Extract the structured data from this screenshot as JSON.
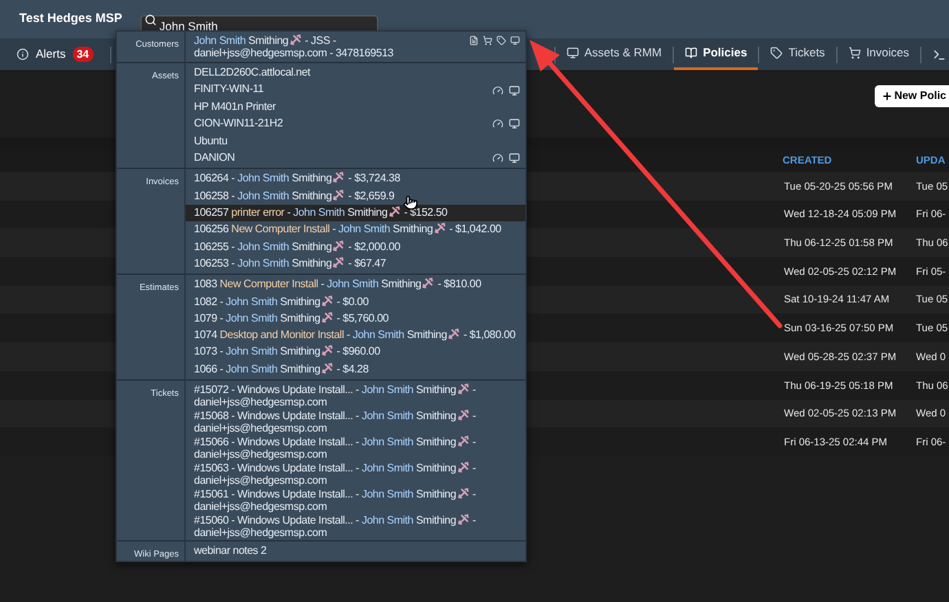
{
  "app_title": "Test Hedges MSP",
  "search": {
    "value": "John Smith"
  },
  "nav": {
    "alerts": {
      "label": "Alerts",
      "count": "34"
    },
    "tabs": [
      {
        "label": "Assets & RMM",
        "selected": false
      },
      {
        "label": "Policies",
        "selected": true
      },
      {
        "label": "Tickets",
        "selected": false
      },
      {
        "label": "Invoices",
        "selected": false
      }
    ]
  },
  "results": [
    {
      "label": "Customers",
      "kind": "customer",
      "items": [
        {
          "hovered": false,
          "parts": [
            {
              "kind": "match",
              "t": "John Smith"
            },
            {
              "kind": "text",
              "t": " Smithing"
            },
            {
              "kind": "icon"
            },
            {
              "kind": "text",
              "t": " - JSS - daniel+jss@hedgesmsp.com - 3478169513"
            }
          ]
        }
      ]
    },
    {
      "label": "Assets",
      "kind": "asset",
      "items": [
        {
          "hovered": false,
          "agent": false,
          "parts": [
            {
              "kind": "text",
              "t": "DELL2D260C.attlocal.net"
            }
          ]
        },
        {
          "hovered": false,
          "agent": true,
          "parts": [
            {
              "kind": "text",
              "t": "FINITY-WIN-11"
            }
          ]
        },
        {
          "hovered": false,
          "agent": false,
          "parts": [
            {
              "kind": "text",
              "t": "HP M401n Printer"
            }
          ]
        },
        {
          "hovered": false,
          "agent": true,
          "parts": [
            {
              "kind": "text",
              "t": "CION-WIN11-21H2"
            }
          ]
        },
        {
          "hovered": false,
          "agent": false,
          "parts": [
            {
              "kind": "text",
              "t": "Ubuntu"
            }
          ]
        },
        {
          "hovered": false,
          "agent": true,
          "parts": [
            {
              "kind": "text",
              "t": "DANION"
            }
          ]
        }
      ]
    },
    {
      "label": "Invoices",
      "kind": "line",
      "items": [
        {
          "hovered": false,
          "parts": [
            {
              "kind": "text",
              "t": "106264 - "
            },
            {
              "kind": "match",
              "t": "John Smith"
            },
            {
              "kind": "text",
              "t": " Smithing"
            },
            {
              "kind": "icon"
            },
            {
              "kind": "text",
              "t": " - $3,724.38"
            }
          ]
        },
        {
          "hovered": false,
          "parts": [
            {
              "kind": "text",
              "t": "106258 - "
            },
            {
              "kind": "match",
              "t": "John Smith"
            },
            {
              "kind": "text",
              "t": " Smithing"
            },
            {
              "kind": "icon"
            },
            {
              "kind": "text",
              "t": " - $2,659.9"
            }
          ]
        },
        {
          "hovered": true,
          "parts": [
            {
              "kind": "text",
              "t": "106257 "
            },
            {
              "kind": "accent",
              "t": "printer error"
            },
            {
              "kind": "text",
              "t": " - "
            },
            {
              "kind": "match",
              "t": "John Smith"
            },
            {
              "kind": "text",
              "t": " Smithing"
            },
            {
              "kind": "icon"
            },
            {
              "kind": "text",
              "t": " - $152.50"
            }
          ]
        },
        {
          "hovered": false,
          "parts": [
            {
              "kind": "text",
              "t": "106256 "
            },
            {
              "kind": "accent",
              "t": "New Computer Install"
            },
            {
              "kind": "text",
              "t": " - "
            },
            {
              "kind": "match",
              "t": "John Smith"
            },
            {
              "kind": "text",
              "t": " Smithing"
            },
            {
              "kind": "icon"
            },
            {
              "kind": "text",
              "t": " - $1,042.00"
            }
          ]
        },
        {
          "hovered": false,
          "parts": [
            {
              "kind": "text",
              "t": "106255 - "
            },
            {
              "kind": "match",
              "t": "John Smith"
            },
            {
              "kind": "text",
              "t": " Smithing"
            },
            {
              "kind": "icon"
            },
            {
              "kind": "text",
              "t": " - $2,000.00"
            }
          ]
        },
        {
          "hovered": false,
          "parts": [
            {
              "kind": "text",
              "t": "106253 - "
            },
            {
              "kind": "match",
              "t": "John Smith"
            },
            {
              "kind": "text",
              "t": " Smithing"
            },
            {
              "kind": "icon"
            },
            {
              "kind": "text",
              "t": " - $67.47"
            }
          ]
        }
      ]
    },
    {
      "label": "Estimates",
      "kind": "line",
      "items": [
        {
          "hovered": false,
          "parts": [
            {
              "kind": "text",
              "t": "1083 "
            },
            {
              "kind": "accent",
              "t": "New Computer Install"
            },
            {
              "kind": "text",
              "t": " - "
            },
            {
              "kind": "match",
              "t": "John Smith"
            },
            {
              "kind": "text",
              "t": " Smithing"
            },
            {
              "kind": "icon"
            },
            {
              "kind": "text",
              "t": " - $810.00"
            }
          ]
        },
        {
          "hovered": false,
          "parts": [
            {
              "kind": "text",
              "t": "1082 - "
            },
            {
              "kind": "match",
              "t": "John Smith"
            },
            {
              "kind": "text",
              "t": " Smithing"
            },
            {
              "kind": "icon"
            },
            {
              "kind": "text",
              "t": " - $0.00"
            }
          ]
        },
        {
          "hovered": false,
          "parts": [
            {
              "kind": "text",
              "t": "1079 - "
            },
            {
              "kind": "match",
              "t": "John Smith"
            },
            {
              "kind": "text",
              "t": " Smithing"
            },
            {
              "kind": "icon"
            },
            {
              "kind": "text",
              "t": " - $5,760.00"
            }
          ]
        },
        {
          "hovered": false,
          "parts": [
            {
              "kind": "text",
              "t": "1074 "
            },
            {
              "kind": "accent",
              "t": "Desktop and Monitor Install"
            },
            {
              "kind": "text",
              "t": " - "
            },
            {
              "kind": "match",
              "t": "John Smith"
            },
            {
              "kind": "text",
              "t": " Smithing"
            },
            {
              "kind": "icon"
            },
            {
              "kind": "text",
              "t": " - $1,080.00"
            }
          ]
        },
        {
          "hovered": false,
          "parts": [
            {
              "kind": "text",
              "t": "1073 - "
            },
            {
              "kind": "match",
              "t": "John Smith"
            },
            {
              "kind": "text",
              "t": " Smithing"
            },
            {
              "kind": "icon"
            },
            {
              "kind": "text",
              "t": " - $960.00"
            }
          ]
        },
        {
          "hovered": false,
          "parts": [
            {
              "kind": "text",
              "t": "1066 - "
            },
            {
              "kind": "match",
              "t": "John Smith"
            },
            {
              "kind": "text",
              "t": " Smithing"
            },
            {
              "kind": "icon"
            },
            {
              "kind": "text",
              "t": " - $4.28"
            }
          ]
        }
      ]
    },
    {
      "label": "Tickets",
      "kind": "ticket",
      "items": [
        {
          "hovered": false,
          "parts": [
            {
              "kind": "text",
              "t": "#15072 - Windows Update Install... - "
            },
            {
              "kind": "match",
              "t": "John Smith"
            },
            {
              "kind": "text",
              "t": " Smithing"
            },
            {
              "kind": "icon"
            },
            {
              "kind": "text",
              "t": " - daniel+jss@hedgesmsp.com"
            }
          ]
        },
        {
          "hovered": false,
          "parts": [
            {
              "kind": "text",
              "t": "#15068 - Windows Update Install... - "
            },
            {
              "kind": "match",
              "t": "John Smith"
            },
            {
              "kind": "text",
              "t": " Smithing"
            },
            {
              "kind": "icon"
            },
            {
              "kind": "text",
              "t": " - daniel+jss@hedgesmsp.com"
            }
          ]
        },
        {
          "hovered": false,
          "parts": [
            {
              "kind": "text",
              "t": "#15066 - Windows Update Install... - "
            },
            {
              "kind": "match",
              "t": "John Smith"
            },
            {
              "kind": "text",
              "t": " Smithing"
            },
            {
              "kind": "icon"
            },
            {
              "kind": "text",
              "t": " - daniel+jss@hedgesmsp.com"
            }
          ]
        },
        {
          "hovered": false,
          "parts": [
            {
              "kind": "text",
              "t": "#15063 - Windows Update Install... - "
            },
            {
              "kind": "match",
              "t": "John Smith"
            },
            {
              "kind": "text",
              "t": " Smithing"
            },
            {
              "kind": "icon"
            },
            {
              "kind": "text",
              "t": " - daniel+jss@hedgesmsp.com"
            }
          ]
        },
        {
          "hovered": false,
          "parts": [
            {
              "kind": "text",
              "t": "#15061 - Windows Update Install... - "
            },
            {
              "kind": "match",
              "t": "John Smith"
            },
            {
              "kind": "text",
              "t": " Smithing"
            },
            {
              "kind": "icon"
            },
            {
              "kind": "text",
              "t": " - daniel+jss@hedgesmsp.com"
            }
          ]
        },
        {
          "hovered": false,
          "parts": [
            {
              "kind": "text",
              "t": "#15060 - Windows Update Install... - "
            },
            {
              "kind": "match",
              "t": "John Smith"
            },
            {
              "kind": "text",
              "t": " Smithing"
            },
            {
              "kind": "icon"
            },
            {
              "kind": "text",
              "t": " - daniel+jss@hedgesmsp.com"
            }
          ]
        }
      ]
    },
    {
      "label": "Wiki Pages",
      "kind": "line",
      "items": [
        {
          "hovered": false,
          "parts": [
            {
              "kind": "text",
              "t": "webinar notes 2"
            }
          ]
        }
      ]
    }
  ],
  "new_button": "New Polic",
  "table": {
    "columns": [
      "CREATED",
      "UPDA"
    ],
    "rows": [
      [
        "Tue 05-20-25 05:56 PM",
        "Tue 05"
      ],
      [
        "Wed 12-18-24 05:09 PM",
        "Fri 06-"
      ],
      [
        "Thu 06-12-25 01:58 PM",
        "Thu 06"
      ],
      [
        "Wed 02-05-25 02:12 PM",
        "Fri 05-"
      ],
      [
        "Sat 10-19-24 11:47 AM",
        "Tue 05"
      ],
      [
        "Sun 03-16-25 07:50 PM",
        "Tue 05"
      ],
      [
        "Wed 05-28-25 02:37 PM",
        "Wed 0"
      ],
      [
        "Thu 06-19-25 05:18 PM",
        "Thu 06"
      ],
      [
        "Wed 02-05-25 02:13 PM",
        "Wed 0"
      ],
      [
        "Fri 06-13-25 02:44 PM",
        "Fri 06-"
      ]
    ]
  }
}
